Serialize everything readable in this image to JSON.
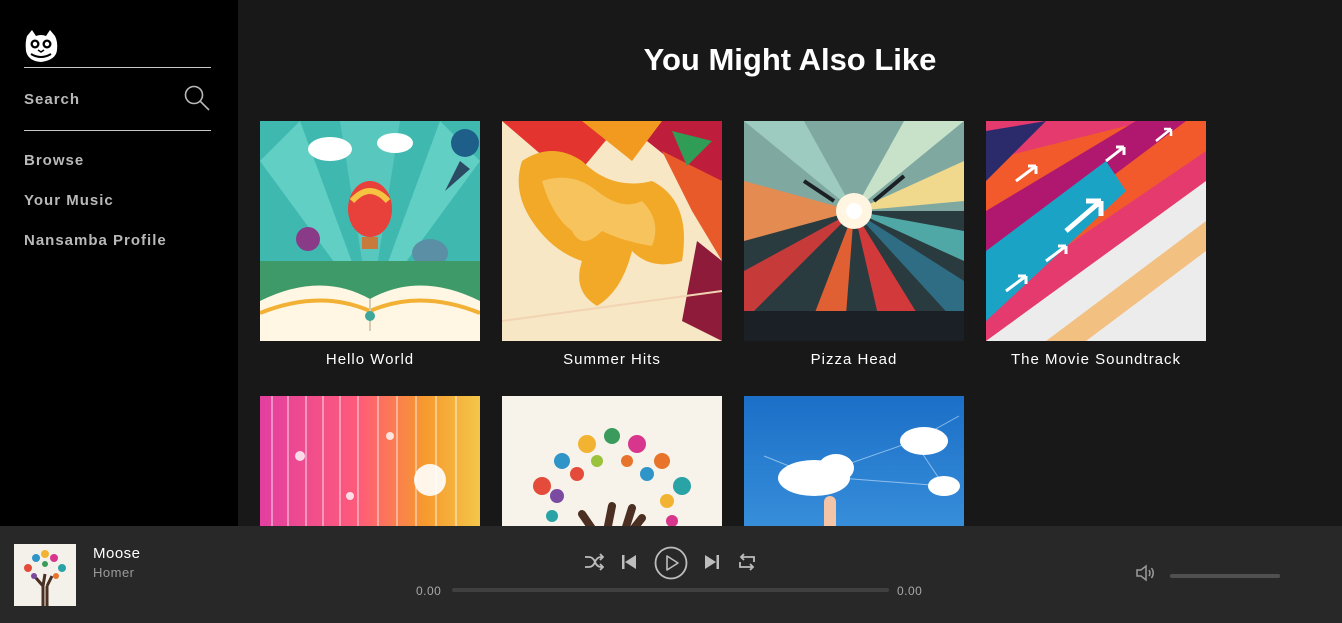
{
  "sidebar": {
    "logo_icon": "cat-logo-icon",
    "search_label": "Search",
    "search_icon": "search-icon",
    "nav": [
      {
        "label": "Browse"
      },
      {
        "label": "Your Music"
      },
      {
        "label": "Nansamba Profile"
      }
    ]
  },
  "main": {
    "title": "You Might Also Like",
    "cards": [
      {
        "title": "Hello World"
      },
      {
        "title": "Summer Hits"
      },
      {
        "title": "Pizza Head"
      },
      {
        "title": "The Movie Soundtrack"
      },
      {
        "title": ""
      },
      {
        "title": ""
      },
      {
        "title": ""
      }
    ]
  },
  "player": {
    "track_title": "Moose",
    "track_artist": "Homer",
    "time_current": "0.00",
    "time_total": "0.00",
    "progress": 0,
    "volume": 1.0,
    "controls": [
      "shuffle-icon",
      "previous-icon",
      "play-icon",
      "next-icon",
      "repeat-icon",
      "volume-icon"
    ]
  },
  "colors": {
    "sidebar_bg": "#000000",
    "main_bg": "#181818",
    "player_bg": "#282828",
    "nav_text": "#b9b9b9"
  }
}
